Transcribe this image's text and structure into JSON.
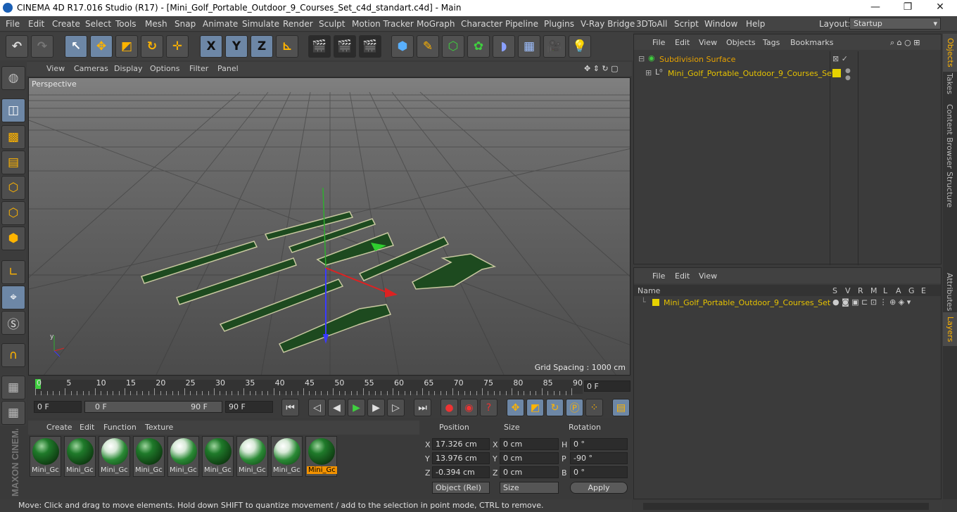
{
  "window": {
    "title": "CINEMA 4D R17.016 Studio (R17) - [Mini_Golf_Portable_Outdoor_9_Courses_Set_c4d_standart.c4d] - Main",
    "controls": [
      "—",
      "❐",
      "✕"
    ]
  },
  "menubar": {
    "items": [
      "File",
      "Edit",
      "Create",
      "Select",
      "Tools",
      "Mesh",
      "Snap",
      "Animate",
      "Simulate",
      "Render",
      "Sculpt",
      "Motion Tracker",
      "MoGraph",
      "Character",
      "Pipeline",
      "Plugins",
      "V-Ray Bridge",
      "3DToAll",
      "Script",
      "Window",
      "Help"
    ],
    "layout_label": "Layout:",
    "layout_value": "Startup"
  },
  "toolbar": {
    "axis_x": "X",
    "axis_y": "Y",
    "axis_z": "Z"
  },
  "viewport": {
    "menu": [
      "View",
      "Cameras",
      "Display",
      "Options",
      "Filter",
      "Panel"
    ],
    "label": "Perspective",
    "grid_spacing": "Grid Spacing : 1000 cm"
  },
  "timeline": {
    "ticks": [
      "0",
      "5",
      "10",
      "15",
      "20",
      "25",
      "30",
      "35",
      "40",
      "45",
      "50",
      "55",
      "60",
      "65",
      "70",
      "75",
      "80",
      "85",
      "90"
    ],
    "current_frame": "0 F"
  },
  "transport": {
    "start": "0 F",
    "range_start": "0 F",
    "range_end": "90 F",
    "end": "90 F"
  },
  "material_manager": {
    "menu": [
      "Create",
      "Edit",
      "Function",
      "Texture"
    ],
    "materials": [
      "Mini_Gc",
      "Mini_Gc",
      "Mini_Gc",
      "Mini_Gc",
      "Mini_Gc",
      "Mini_Gc",
      "Mini_Gc",
      "Mini_Gc",
      "Mini_Gc"
    ]
  },
  "coordinates": {
    "headers": [
      "Position",
      "Size",
      "Rotation"
    ],
    "rows": [
      {
        "axis": "X",
        "pos": "17.326 cm",
        "saxis": "X",
        "size": "0 cm",
        "raxis": "H",
        "rot": "0 °"
      },
      {
        "axis": "Y",
        "pos": "13.976 cm",
        "saxis": "Y",
        "size": "0 cm",
        "raxis": "P",
        "rot": "-90 °"
      },
      {
        "axis": "Z",
        "pos": "-0.394 cm",
        "saxis": "Z",
        "size": "0 cm",
        "raxis": "B",
        "rot": "0 °"
      }
    ],
    "mode": "Object (Rel)",
    "size_mode": "Size",
    "apply": "Apply"
  },
  "status": "Move: Click and drag to move elements. Hold down SHIFT to quantize movement / add to the selection in point mode, CTRL to remove.",
  "object_manager": {
    "menu": [
      "File",
      "Edit",
      "View",
      "Objects",
      "Tags",
      "Bookmarks"
    ],
    "objects": [
      {
        "name": "Subdivision Surface"
      },
      {
        "name": "Mini_Golf_Portable_Outdoor_9_Courses_Set"
      }
    ]
  },
  "layer_manager": {
    "menu": [
      "File",
      "Edit",
      "View"
    ],
    "name_header": "Name",
    "columns": [
      "S",
      "V",
      "R",
      "M",
      "L",
      "A",
      "G",
      "E"
    ],
    "layers": [
      {
        "name": "Mini_Golf_Portable_Outdoor_9_Courses_Set"
      }
    ]
  },
  "side_tabs": [
    "Objects",
    "Takes",
    "Content Browser",
    "Structure",
    "Attributes",
    "Layers"
  ],
  "colors": {
    "accent": "#ffb400",
    "selected": "#6d87a6",
    "layer_yellow": "#e6d200"
  }
}
